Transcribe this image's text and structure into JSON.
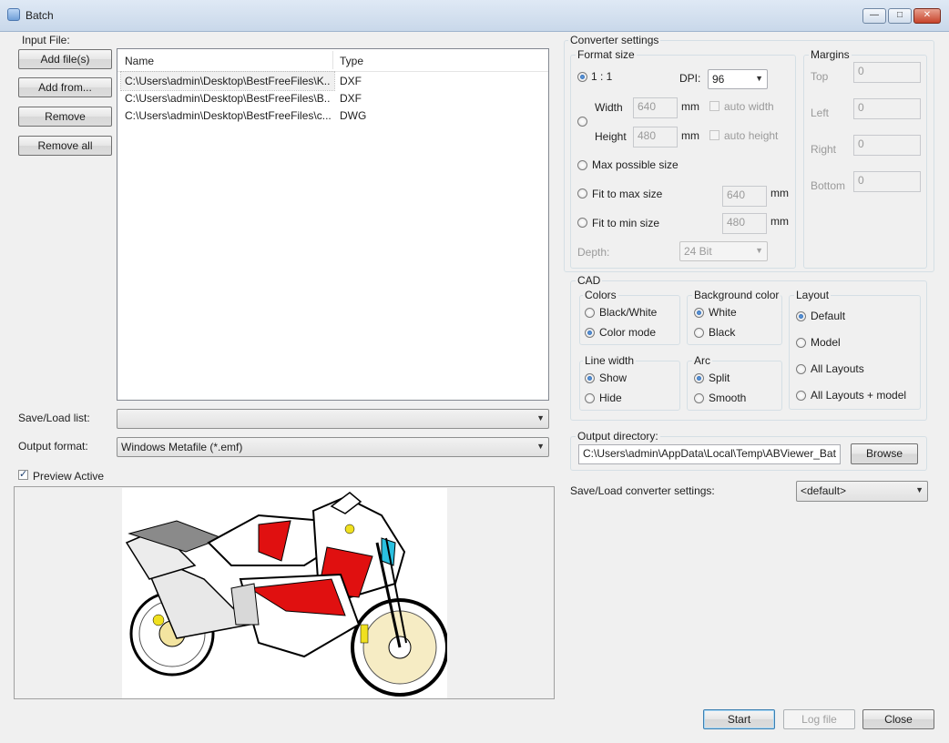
{
  "window": {
    "title": "Batch",
    "controls": {
      "minimize": "—",
      "maximize": "□",
      "close": "✕"
    }
  },
  "input": {
    "label": "Input File:",
    "buttons": {
      "add_files": "Add file(s)",
      "add_from": "Add from...",
      "remove": "Remove",
      "remove_all": "Remove all"
    },
    "columns": {
      "name": "Name",
      "type": "Type"
    },
    "files": [
      {
        "name": "C:\\Users\\admin\\Desktop\\BestFreeFiles\\K...",
        "type": "DXF"
      },
      {
        "name": "C:\\Users\\admin\\Desktop\\BestFreeFiles\\B...",
        "type": "DXF"
      },
      {
        "name": "C:\\Users\\admin\\Desktop\\BestFreeFiles\\c...",
        "type": "DWG"
      }
    ],
    "save_load_list_label": "Save/Load list:",
    "save_load_list_value": "",
    "output_format_label": "Output format:",
    "output_format_value": "Windows Metafile (*.emf)",
    "preview_label": "Preview Active"
  },
  "converter": {
    "label": "Converter settings",
    "format_size": {
      "label": "Format size",
      "ratio_label": "1 : 1",
      "dpi_label": "DPI:",
      "dpi_value": "96",
      "width_label": "Width",
      "width_value": "640",
      "height_label": "Height",
      "height_value": "480",
      "mm": "mm",
      "auto_width": "auto width",
      "auto_height": "auto height",
      "max_possible": "Max possible size",
      "fit_max": "Fit to max size",
      "fit_max_value": "640",
      "fit_min": "Fit to min size",
      "fit_min_value": "480",
      "depth_label": "Depth:",
      "depth_value": "24 Bit"
    },
    "margins": {
      "label": "Margins",
      "top": "Top",
      "left": "Left",
      "right": "Right",
      "bottom": "Bottom",
      "top_value": "0",
      "left_value": "0",
      "right_value": "0",
      "bottom_value": "0"
    }
  },
  "cad": {
    "label": "CAD",
    "colors": {
      "label": "Colors",
      "black_white": "Black/White",
      "color_mode": "Color mode"
    },
    "background": {
      "label": "Background color",
      "white": "White",
      "black": "Black"
    },
    "layout": {
      "label": "Layout",
      "default": "Default",
      "model": "Model",
      "all_layouts": "All Layouts",
      "all_layouts_model": "All Layouts + model"
    },
    "line_width": {
      "label": "Line width",
      "show": "Show",
      "hide": "Hide"
    },
    "arc": {
      "label": "Arc",
      "split": "Split",
      "smooth": "Smooth"
    }
  },
  "output_dir": {
    "label": "Output directory:",
    "value": "C:\\Users\\admin\\AppData\\Local\\Temp\\ABViewer_Bat",
    "browse": "Browse"
  },
  "converter_settings": {
    "label": "Save/Load converter settings:",
    "value": "<default>"
  },
  "footer": {
    "start": "Start",
    "log_file": "Log file",
    "close": "Close"
  },
  "colors": {
    "accent": "#3c7fb1",
    "window_bg": "#f0f0f0",
    "bike_red": "#e01010",
    "bike_yellow": "#f0e020"
  }
}
